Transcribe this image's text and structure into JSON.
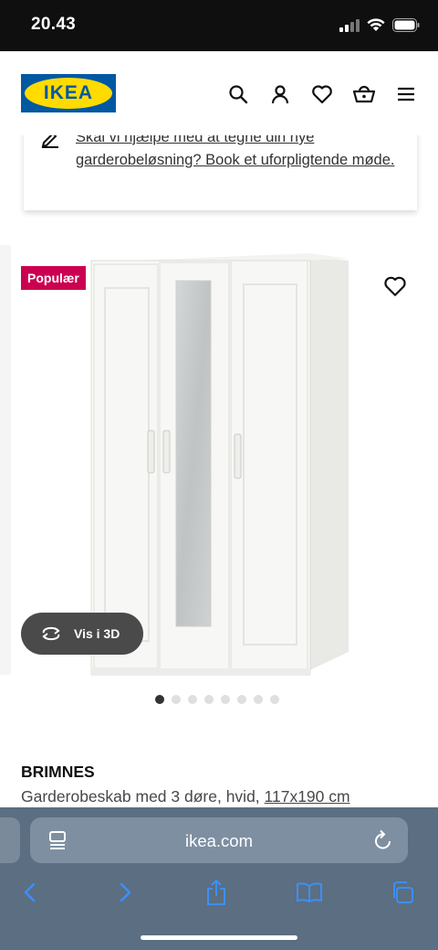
{
  "status": {
    "time": "20.43"
  },
  "header": {
    "logo_text": "IKEA",
    "icons": [
      "search-icon",
      "user-icon",
      "heart-icon",
      "basket-icon",
      "menu-icon"
    ]
  },
  "promo": {
    "text": "Skal vi hjælpe med at tegne din nye garderobeløsning? Book et uforpligtende møde."
  },
  "product": {
    "badge": "Populær",
    "view_3d_label": "Vis i 3D",
    "image_count": 8,
    "active_image": 1,
    "name": "BRIMNES",
    "description": "Garderobeskab med 3 døre, hvid,",
    "size": "117x190 cm"
  },
  "browser": {
    "url": "ikea.com",
    "toolbar": [
      "back-icon",
      "forward-icon",
      "share-icon",
      "bookmarks-icon",
      "tabs-icon"
    ]
  },
  "colors": {
    "ikea_blue": "#0058a3",
    "ikea_yellow": "#ffdb00",
    "badge": "#cc0050",
    "browser_bar": "#5b6e82"
  }
}
